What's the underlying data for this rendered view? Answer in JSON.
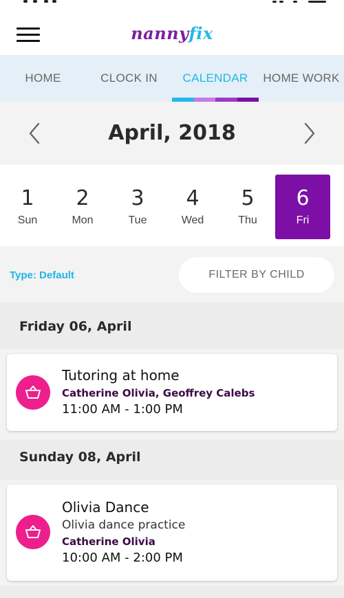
{
  "app": {
    "logo_part1": "nanny",
    "logo_part2": "fix",
    "brand_purple": "#7b0fa6",
    "brand_blue": "#22b5e6",
    "event_pink": "#ee1f8c"
  },
  "header": {
    "menu_icon": "hamburger-menu-icon"
  },
  "tabs": [
    {
      "label": "HOME",
      "active": false
    },
    {
      "label": "CLOCK IN",
      "active": false
    },
    {
      "label": "CALENDAR",
      "active": true
    },
    {
      "label": "HOME WORK",
      "active": false
    }
  ],
  "tab_indicator_colors": [
    "#26b7e8",
    "#c77be3",
    "#9a3bc4",
    "#7b0fa6"
  ],
  "calendar": {
    "month_title": "April, 2018",
    "prev_icon": "chevron-left-icon",
    "next_icon": "chevron-right-icon",
    "days": [
      {
        "num": "1",
        "weekday": "Sun",
        "selected": false
      },
      {
        "num": "2",
        "weekday": "Mon",
        "selected": false
      },
      {
        "num": "3",
        "weekday": "Tue",
        "selected": false
      },
      {
        "num": "4",
        "weekday": "Wed",
        "selected": false
      },
      {
        "num": "5",
        "weekday": "Thu",
        "selected": false
      },
      {
        "num": "6",
        "weekday": "Fri",
        "selected": true
      }
    ]
  },
  "filter": {
    "type_label": "Type: Default",
    "filter_button": "FILTER BY CHILD"
  },
  "sections": [
    {
      "heading": "Friday 06, April",
      "events": [
        {
          "title": "Tutoring at home",
          "children": "Catherine Olivia, Geoffrey Calebs",
          "time": "11:00 AM - 1:00 PM",
          "icon": "basket-icon"
        }
      ]
    },
    {
      "heading": "Sunday 08, April",
      "events": [
        {
          "title": "Olivia Dance",
          "description": "Olivia dance practice",
          "children": "Catherine Olivia",
          "time": "10:00 AM - 2:00 PM",
          "icon": "basket-icon"
        }
      ]
    }
  ]
}
